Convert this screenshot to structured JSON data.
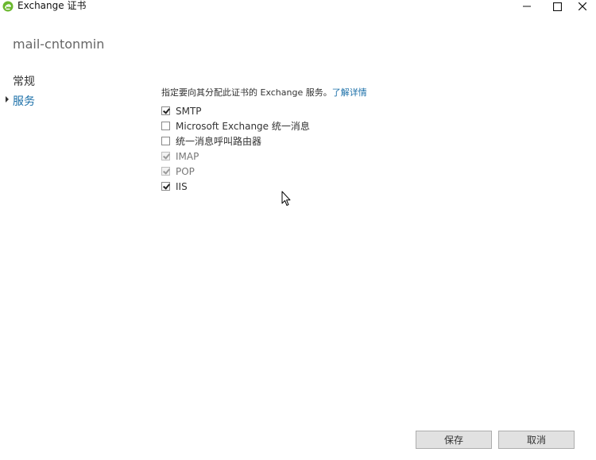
{
  "window": {
    "title": "Exchange 证书"
  },
  "header": {
    "server_name": "mail-cntonmin"
  },
  "nav": {
    "items": [
      {
        "label": "常规",
        "selected": false
      },
      {
        "label": "服务",
        "selected": true
      }
    ]
  },
  "main": {
    "instruction": "指定要向其分配此证书的 Exchange 服务。",
    "learn_more": "了解详情",
    "services": [
      {
        "label": "SMTP",
        "checked": true,
        "disabled": false
      },
      {
        "label": "Microsoft Exchange 统一消息",
        "checked": false,
        "disabled": false
      },
      {
        "label": "统一消息呼叫路由器",
        "checked": false,
        "disabled": false
      },
      {
        "label": "IMAP",
        "checked": true,
        "disabled": true
      },
      {
        "label": "POP",
        "checked": true,
        "disabled": true
      },
      {
        "label": "IIS",
        "checked": true,
        "disabled": false
      }
    ]
  },
  "footer": {
    "save_label": "保存",
    "cancel_label": "取消"
  },
  "colors": {
    "link": "#1a6fa8",
    "selected_nav": "#1a6fa8"
  },
  "icons": [
    "exchange-app-icon",
    "minimize-icon",
    "maximize-icon",
    "close-icon",
    "mouse-cursor-icon"
  ]
}
